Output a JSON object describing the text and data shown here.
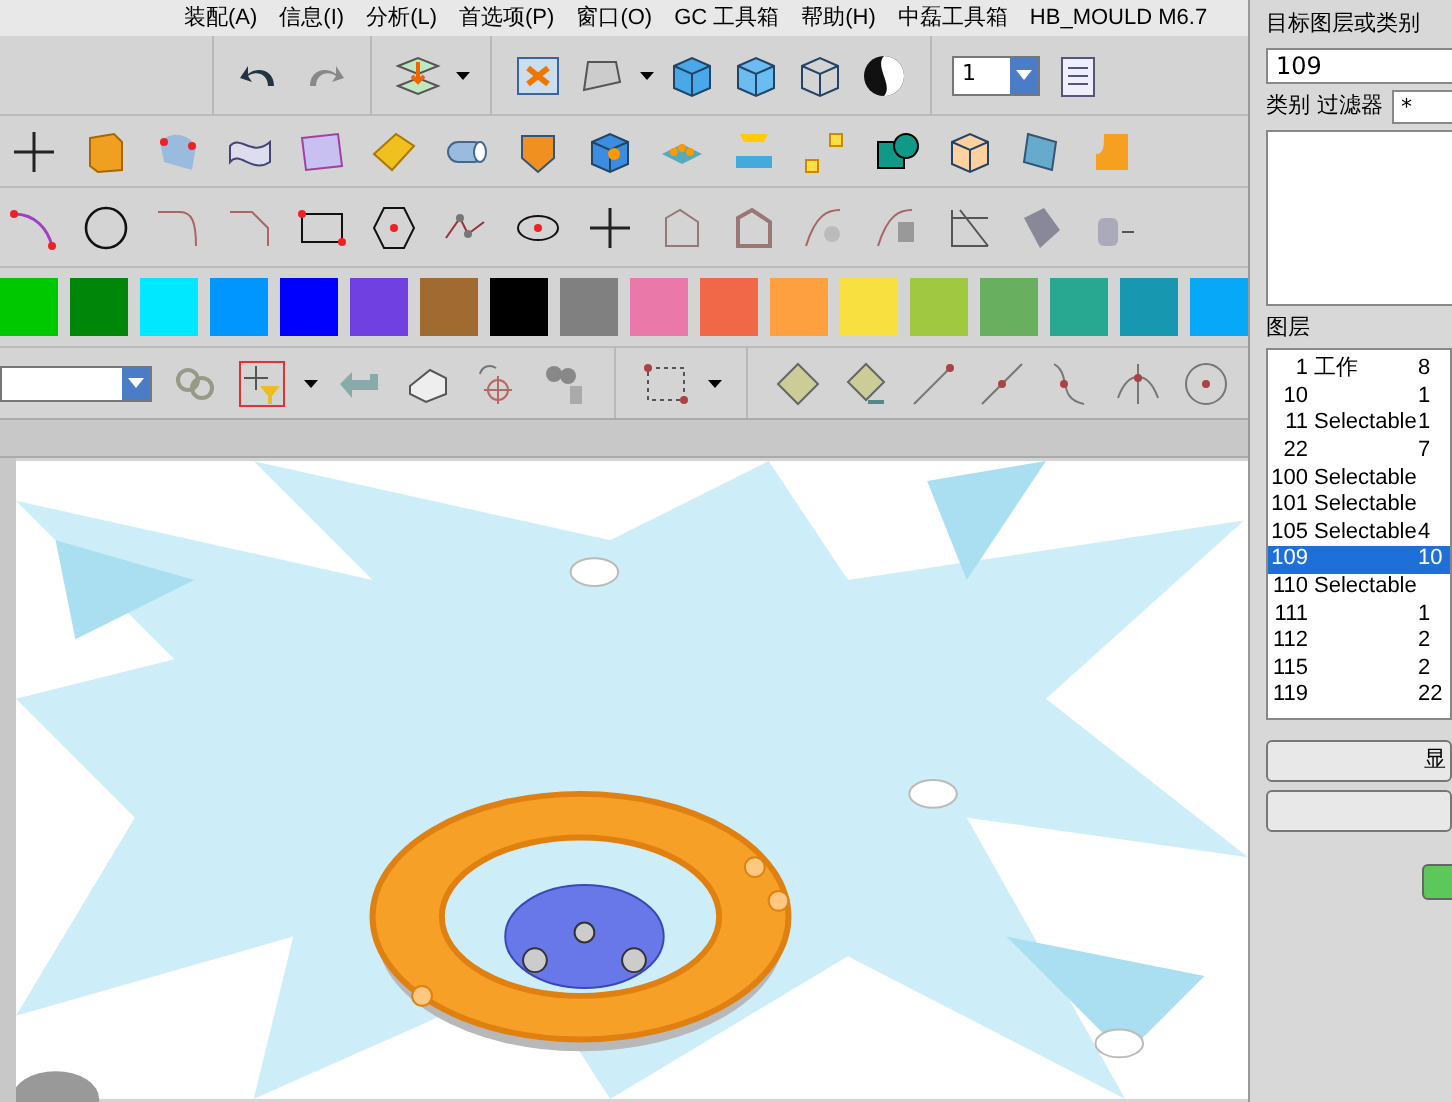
{
  "menu_bar": {
    "items": [
      "装配(A)",
      "信息(I)",
      "分析(L)",
      "首选项(P)",
      "窗口(O)",
      "GC 工具箱",
      "帮助(H)",
      "中磊工具箱",
      "HB_MOULD M6.7"
    ]
  },
  "toolbar": {
    "layer_dropdown": "1"
  },
  "color_palette": [
    {
      "color": "#00c800"
    },
    {
      "color": "#00870a"
    },
    {
      "color": "#00e8ff"
    },
    {
      "color": "#0096ff"
    },
    {
      "color": "#0000ff"
    },
    {
      "color": "#7040e0"
    },
    {
      "color": "#a06a30"
    },
    {
      "color": "#000000"
    },
    {
      "color": "#808080"
    },
    {
      "color": "#ea78a8"
    },
    {
      "color": "#f06848"
    },
    {
      "color": "#ffa040"
    },
    {
      "color": "#f8e040"
    },
    {
      "color": "#a0c840"
    },
    {
      "color": "#68b060"
    },
    {
      "color": "#28a890"
    },
    {
      "color": "#1898b0"
    },
    {
      "color": "#08a8f8"
    }
  ],
  "layer_panel": {
    "target_label": "目标图层或类别",
    "target_value": "109",
    "filter_label": "类别 过滤器",
    "filter_value": "*",
    "layers_label": "图层",
    "layers": [
      {
        "layer": "1",
        "status": "工作",
        "count": "8",
        "selected": false
      },
      {
        "layer": "10",
        "count": "1",
        "selected": false
      },
      {
        "layer": "11",
        "status": "Selectable",
        "count": "1",
        "selected": false
      },
      {
        "layer": "22",
        "count": "7",
        "selected": false
      },
      {
        "layer": "100",
        "status": "Selectable",
        "selected": false
      },
      {
        "layer": "101",
        "status": "Selectable",
        "selected": false
      },
      {
        "layer": "105",
        "status": "Selectable",
        "count": "4",
        "selected": false
      },
      {
        "layer": "109",
        "count": "10",
        "selected": true
      },
      {
        "layer": "110",
        "status": "Selectable",
        "selected": false
      },
      {
        "layer": "111",
        "count": "1",
        "selected": false
      },
      {
        "layer": "112",
        "count": "2",
        "selected": false
      },
      {
        "layer": "115",
        "count": "2",
        "selected": false
      },
      {
        "layer": "119",
        "count": "22",
        "selected": false
      }
    ],
    "buttons": [
      "显"
    ]
  }
}
